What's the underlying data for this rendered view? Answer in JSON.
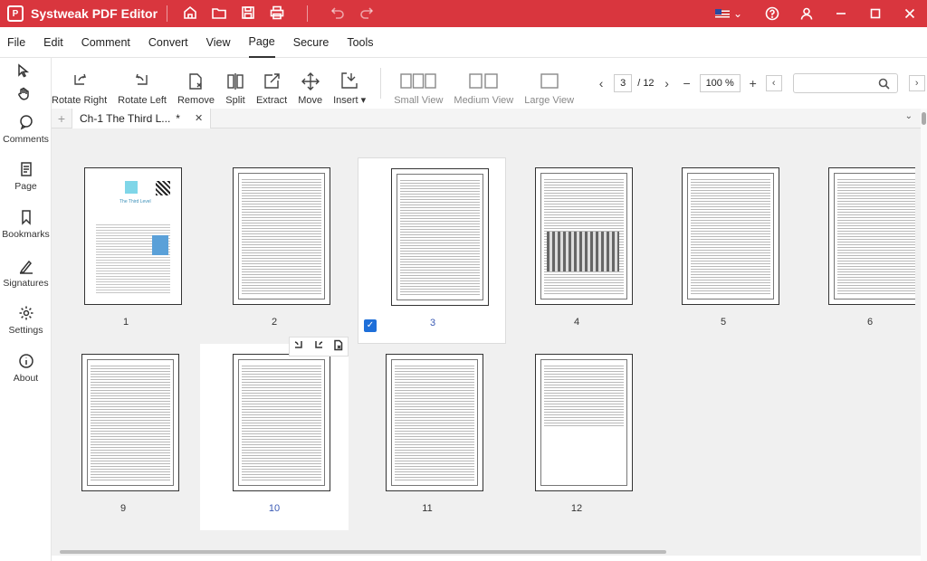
{
  "app": {
    "title": "Systweak PDF Editor",
    "logo_letter": "P"
  },
  "menu": [
    "File",
    "Edit",
    "Comment",
    "Convert",
    "View",
    "Page",
    "Secure",
    "Tools"
  ],
  "menu_active": "Page",
  "toolbar": {
    "rotate_right": "Rotate Right",
    "rotate_left": "Rotate Left",
    "remove": "Remove",
    "split": "Split",
    "extract": "Extract",
    "move": "Move",
    "insert": "Insert",
    "small_view": "Small View",
    "medium_view": "Medium View",
    "large_view": "Large View"
  },
  "pager": {
    "current": "3",
    "total": "/ 12",
    "zoom": "100 %"
  },
  "search": {
    "placeholder": ""
  },
  "sidebar": [
    "Comments",
    "Page",
    "Bookmarks",
    "Signatures",
    "Settings",
    "About"
  ],
  "tab": {
    "label": "Ch-1 The Third L...",
    "modified": "*"
  },
  "pages": [
    {
      "label": "1",
      "cover_title": "The Third Level"
    },
    {
      "label": "2"
    },
    {
      "label": "3",
      "selected": true
    },
    {
      "label": "4"
    },
    {
      "label": "5"
    },
    {
      "label": "6"
    },
    {
      "label": "9"
    },
    {
      "label": "10",
      "hover": true
    },
    {
      "label": "11"
    },
    {
      "label": "12"
    }
  ],
  "colors": {
    "titlebar": "#d9363e",
    "selection": "#1e6fd9",
    "link_label": "#3b5bb5"
  }
}
